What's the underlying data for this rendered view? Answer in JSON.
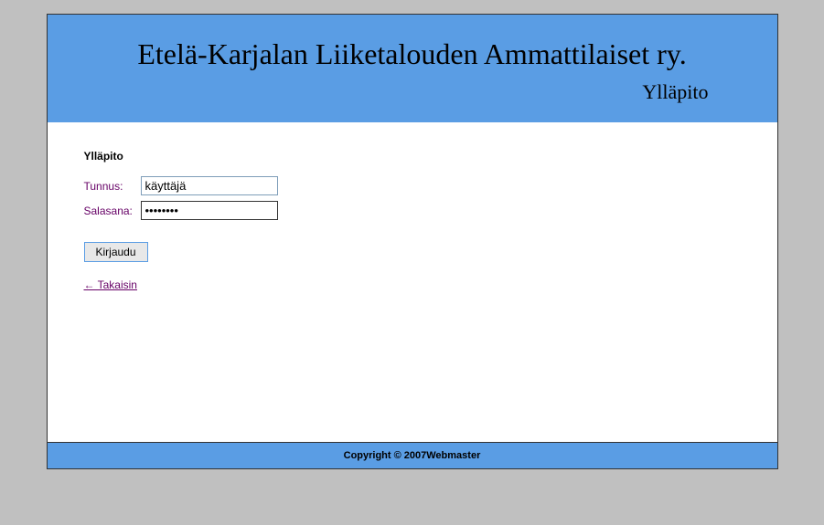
{
  "header": {
    "title": "Etelä-Karjalan Liiketalouden Ammattilaiset ry.",
    "subtitle": "Ylläpito"
  },
  "login": {
    "section_title": "Ylläpito",
    "username_label": "Tunnus:",
    "username_value": "käyttäjä",
    "password_label": "Salasana:",
    "password_value": "••••••••",
    "button_label": "Kirjaudu",
    "back_link": "← Takaisin"
  },
  "footer": {
    "text": "Copyright © 2007Webmaster"
  }
}
